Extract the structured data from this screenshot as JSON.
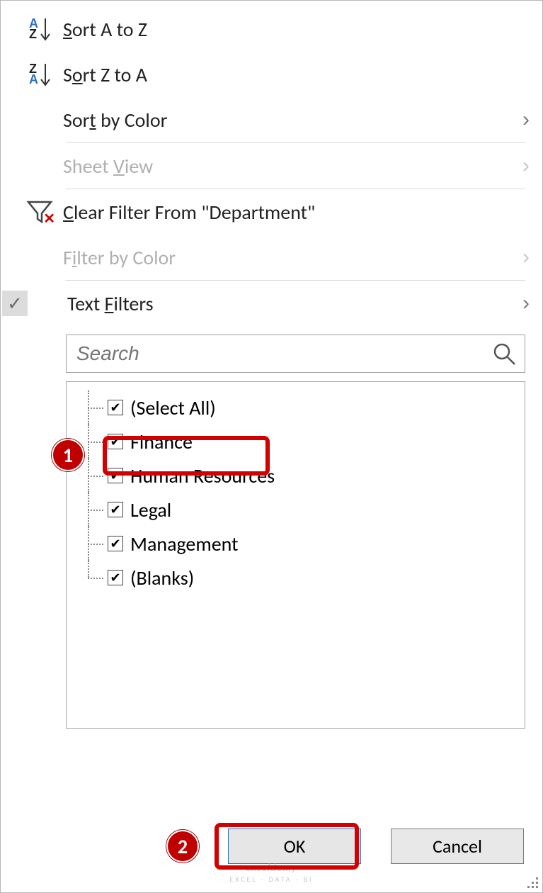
{
  "menu": {
    "sort_asc": "Sort A to Z",
    "sort_desc": "Sort Z to A",
    "sort_by_color": "Sort by Color",
    "sheet_view": "Sheet View",
    "clear_filter": "Clear Filter From \"Department\"",
    "filter_by_color": "Filter by Color",
    "text_filters": "Text Filters"
  },
  "search": {
    "placeholder": "Search"
  },
  "tree": {
    "items": [
      {
        "label": "(Select All)",
        "checked": true
      },
      {
        "label": "Finance",
        "checked": true
      },
      {
        "label": "Human Resources",
        "checked": true
      },
      {
        "label": "Legal",
        "checked": true
      },
      {
        "label": "Management",
        "checked": true
      },
      {
        "label": "(Blanks)",
        "checked": true
      }
    ]
  },
  "buttons": {
    "ok": "OK",
    "cancel": "Cancel"
  },
  "badges": {
    "one": "1",
    "two": "2"
  },
  "watermark": {
    "brand": "exceldemy",
    "tag": "EXCEL · DATA · BI"
  }
}
